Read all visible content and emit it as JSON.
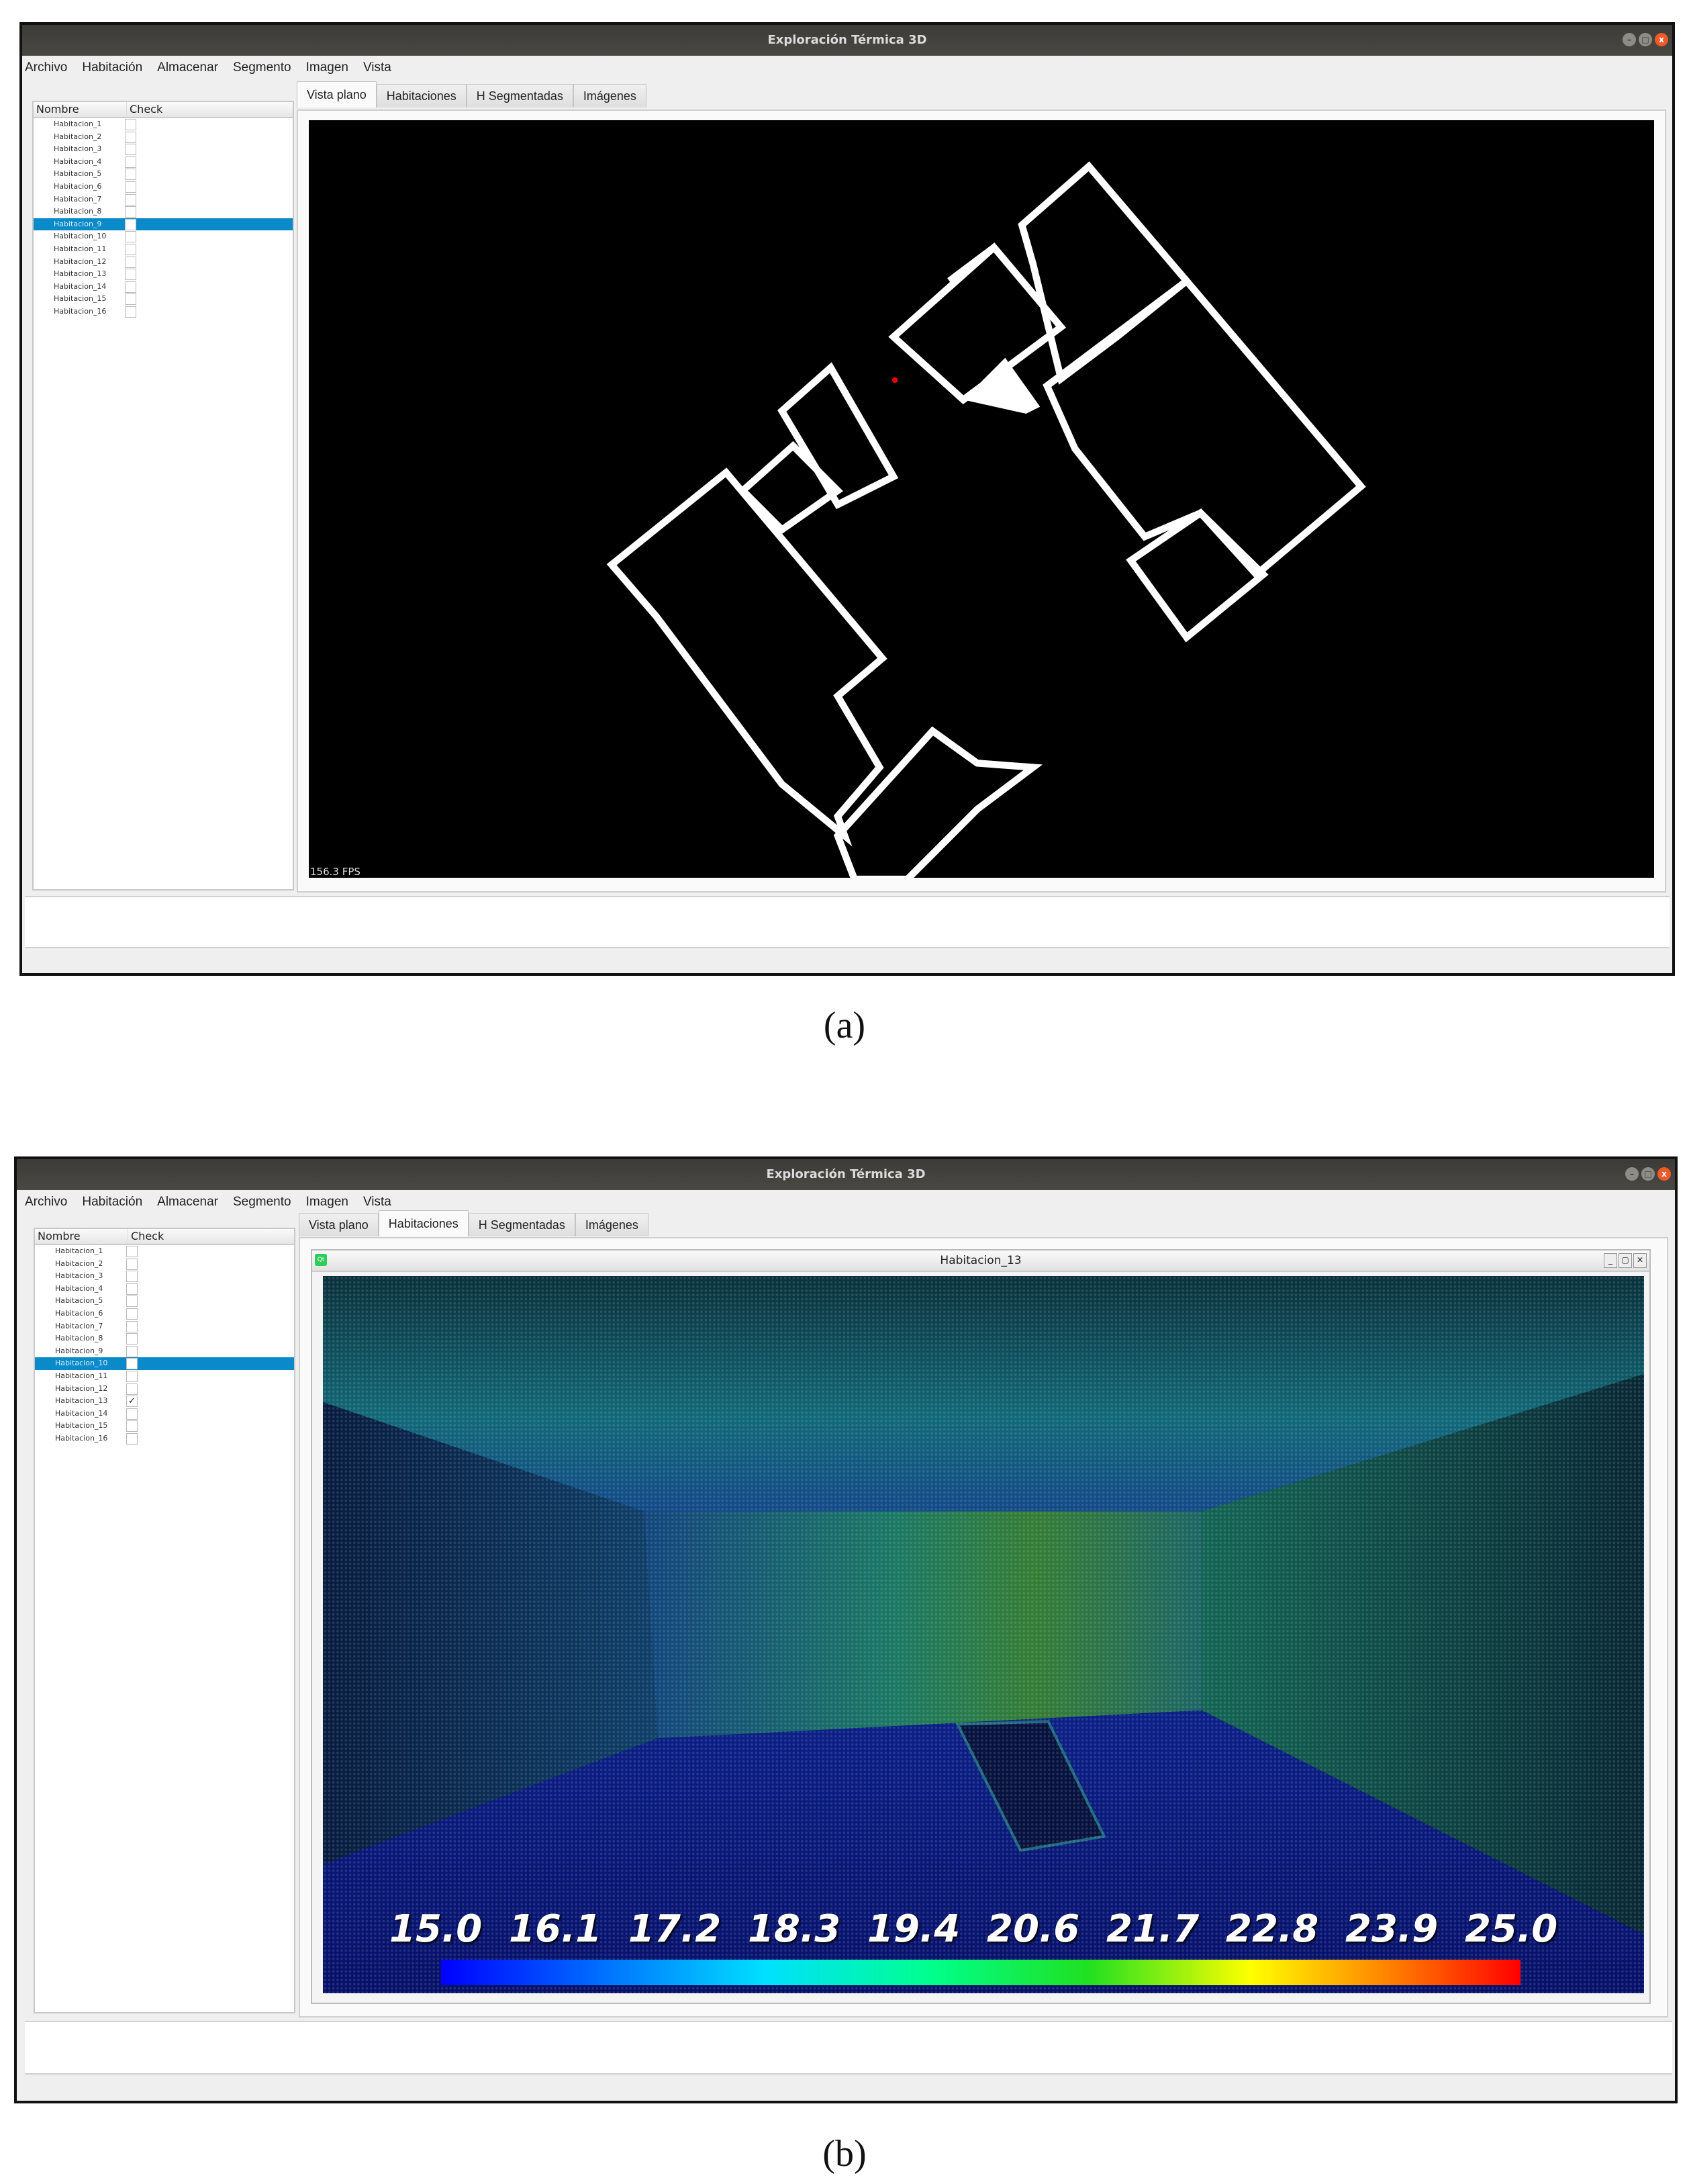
{
  "window_title": "Exploración Térmica 3D",
  "window_buttons": {
    "minimize": "–",
    "maximize": "□",
    "close": "x"
  },
  "menu": [
    "Archivo",
    "Habitación",
    "Almacenar",
    "Segmento",
    "Imagen",
    "Vista"
  ],
  "sidebar": {
    "col_name": "Nombre",
    "col_check": "Check",
    "items": [
      "Habitacion_1",
      "Habitacion_2",
      "Habitacion_3",
      "Habitacion_4",
      "Habitacion_5",
      "Habitacion_6",
      "Habitacion_7",
      "Habitacion_8",
      "Habitacion_9",
      "Habitacion_10",
      "Habitacion_11",
      "Habitacion_12",
      "Habitacion_13",
      "Habitacion_14",
      "Habitacion_15",
      "Habitacion_16"
    ]
  },
  "tabs": [
    "Vista plano",
    "Habitaciones",
    "H Segmentadas",
    "Imágenes"
  ],
  "panel_a": {
    "caption": "(a)",
    "active_tab": 0,
    "selected_item": 8,
    "checked_items": [],
    "fps": "156.3 FPS"
  },
  "panel_b": {
    "caption": "(b)",
    "active_tab": 1,
    "selected_item": 9,
    "checked_items": [
      12
    ],
    "check_mark": "✓",
    "subwindow_title": "Habitacion_13",
    "subwindow_icon": "Qt",
    "subwindow_buttons": {
      "minimize": "_",
      "restore": "▢",
      "close": "✕"
    },
    "temperature_scale": [
      "15.0",
      "16.1",
      "17.2",
      "18.3",
      "19.4",
      "20.6",
      "21.7",
      "22.8",
      "23.9",
      "25.0"
    ],
    "temperature_range": [
      15.0,
      25.0
    ]
  },
  "colors": {
    "selection": "#0a8ac8",
    "titlebar": "#3c3b37",
    "close_button": "#ef5a29"
  }
}
